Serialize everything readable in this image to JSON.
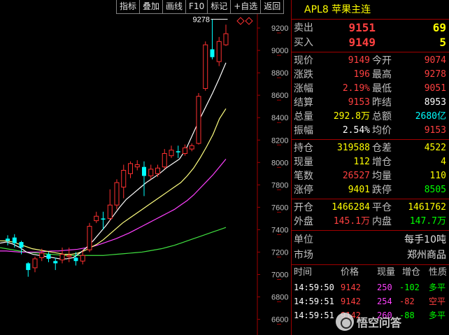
{
  "toolbar": [
    "指标",
    "叠加",
    "画线",
    "F10",
    "标记",
    "+自选",
    "返回"
  ],
  "symbol_title": "APL8 苹果主连",
  "chart_data": {
    "type": "candlestick",
    "y_ticks": [
      9200,
      9000,
      8800,
      8600,
      8400,
      8200,
      8000,
      7800,
      7600,
      7400,
      7200,
      7000,
      6800,
      6600
    ],
    "ylim": [
      6460,
      9450
    ],
    "annotation": "9278",
    "candles": [
      {
        "o": 7320,
        "c": 7300,
        "h": 7350,
        "l": 7260
      },
      {
        "o": 7330,
        "c": 7280,
        "h": 7360,
        "l": 7240
      },
      {
        "o": 7290,
        "c": 7240,
        "h": 7300,
        "l": 7180
      },
      {
        "o": 7100,
        "c": 7040,
        "h": 7110,
        "l": 6980
      },
      {
        "o": 7060,
        "c": 7140,
        "h": 7160,
        "l": 7020
      },
      {
        "o": 7150,
        "c": 7190,
        "h": 7230,
        "l": 7120
      },
      {
        "o": 7180,
        "c": 7140,
        "h": 7200,
        "l": 7110
      },
      {
        "o": 7120,
        "c": 7100,
        "h": 7150,
        "l": 7040
      },
      {
        "o": 7130,
        "c": 7180,
        "h": 7240,
        "l": 7100
      },
      {
        "o": 7160,
        "c": 7170,
        "h": 7240,
        "l": 7110
      },
      {
        "o": 7150,
        "c": 7120,
        "h": 7200,
        "l": 7080
      },
      {
        "o": 7120,
        "c": 7170,
        "h": 7220,
        "l": 7090
      },
      {
        "o": 7220,
        "c": 7430,
        "h": 7460,
        "l": 7200
      },
      {
        "o": 7480,
        "c": 7520,
        "h": 7560,
        "l": 7460
      },
      {
        "o": 7500,
        "c": 7490,
        "h": 7560,
        "l": 7400
      },
      {
        "o": 7500,
        "c": 7620,
        "h": 7760,
        "l": 7480
      },
      {
        "o": 7620,
        "c": 7820,
        "h": 7850,
        "l": 7580
      },
      {
        "o": 7780,
        "c": 7930,
        "h": 7980,
        "l": 7680
      },
      {
        "o": 7900,
        "c": 7990,
        "h": 8010,
        "l": 7860
      },
      {
        "o": 7960,
        "c": 7980,
        "h": 8020,
        "l": 7930
      },
      {
        "o": 7960,
        "c": 7880,
        "h": 8010,
        "l": 7700
      },
      {
        "o": 7880,
        "c": 7940,
        "h": 7980,
        "l": 7850
      },
      {
        "o": 7900,
        "c": 7950,
        "h": 7980,
        "l": 7870
      },
      {
        "o": 7960,
        "c": 8080,
        "h": 8120,
        "l": 7940
      },
      {
        "o": 8060,
        "c": 8110,
        "h": 8150,
        "l": 8040
      },
      {
        "o": 8100,
        "c": 8090,
        "h": 8150,
        "l": 8040
      },
      {
        "o": 8080,
        "c": 8130,
        "h": 8160,
        "l": 8060
      },
      {
        "o": 8120,
        "c": 8150,
        "h": 8170,
        "l": 8100
      },
      {
        "o": 8170,
        "c": 8590,
        "h": 8620,
        "l": 8160
      },
      {
        "o": 8660,
        "c": 9050,
        "h": 9080,
        "l": 8640
      },
      {
        "o": 9010,
        "c": 8940,
        "h": 9278,
        "l": 8920
      },
      {
        "o": 8900,
        "c": 9080,
        "h": 9120,
        "l": 8860
      },
      {
        "o": 9050,
        "c": 9149,
        "h": 9230,
        "l": 9040
      }
    ],
    "ma_white": [
      7280,
      7290,
      7270,
      7240,
      7200,
      7180,
      7170,
      7160,
      7150,
      7140,
      7140,
      7150,
      7190,
      7240,
      7300,
      7370,
      7440,
      7520,
      7600,
      7670,
      7720,
      7770,
      7820,
      7860,
      7900,
      7950,
      7990,
      8030,
      8120,
      8250,
      8380,
      8500,
      8620,
      8750,
      8890
    ],
    "ma_yellow": [
      7300,
      7300,
      7290,
      7270,
      7250,
      7230,
      7220,
      7210,
      7200,
      7190,
      7180,
      7180,
      7190,
      7210,
      7240,
      7270,
      7310,
      7360,
      7410,
      7460,
      7500,
      7540,
      7580,
      7620,
      7660,
      7700,
      7740,
      7780,
      7820,
      7880,
      7950,
      8040,
      8140,
      8250,
      8390,
      8480
    ],
    "ma_magenta": [
      7210,
      7210,
      7205,
      7200,
      7200,
      7200,
      7200,
      7205,
      7210,
      7210,
      7215,
      7220,
      7225,
      7235,
      7245,
      7260,
      7280,
      7300,
      7320,
      7345,
      7370,
      7400,
      7430,
      7460,
      7490,
      7520,
      7550,
      7580,
      7620,
      7660,
      7710,
      7770,
      7830,
      7890,
      7960,
      8030
    ],
    "ma_green": [
      7240,
      7230,
      7220,
      7210,
      7200,
      7195,
      7190,
      7185,
      7180,
      7175,
      7170,
      7170,
      7170,
      7170,
      7170,
      7170,
      7170,
      7175,
      7180,
      7185,
      7190,
      7195,
      7200,
      7210,
      7220,
      7230,
      7245,
      7260,
      7280,
      7300,
      7320,
      7340,
      7360,
      7380,
      7400,
      7420
    ]
  },
  "quote": {
    "sell": {
      "label": "卖出",
      "price": "9151",
      "vol": "69"
    },
    "buy": {
      "label": "买入",
      "price": "9149",
      "vol": "5"
    }
  },
  "stats1": [
    {
      "l1": "现价",
      "v1": "9149",
      "c1": "red",
      "l2": "今开",
      "v2": "9074",
      "c2": "red"
    },
    {
      "l1": "涨跌",
      "v1": "196",
      "c1": "red",
      "l2": "最高",
      "v2": "9278",
      "c2": "red"
    },
    {
      "l1": "涨幅",
      "v1": "2.19%",
      "c1": "red",
      "l2": "最低",
      "v2": "9051",
      "c2": "red"
    },
    {
      "l1": "结算",
      "v1": "9153",
      "c1": "red",
      "l2": "昨结",
      "v2": "8953",
      "c2": "white"
    },
    {
      "l1": "总量",
      "v1": "292.8万",
      "c1": "yellow",
      "l2": "总额",
      "v2": "2680亿",
      "c2": "cyan"
    },
    {
      "l1": "振幅",
      "v1": "2.54%",
      "c1": "white",
      "l2": "均价",
      "v2": "9153",
      "c2": "red"
    }
  ],
  "stats2": [
    {
      "l1": "持仓",
      "v1": "319588",
      "c1": "yellow",
      "l2": "仓差",
      "v2": "4522",
      "c2": "yellow"
    },
    {
      "l1": "现量",
      "v1": "112",
      "c1": "yellow",
      "l2": "增仓",
      "v2": "4",
      "c2": "yellow"
    },
    {
      "l1": "笔数",
      "v1": "26527",
      "c1": "red",
      "l2": "均量",
      "v2": "110",
      "c2": "yellow"
    },
    {
      "l1": "涨停",
      "v1": "9401",
      "c1": "yellow",
      "l2": "跌停",
      "v2": "8505",
      "c2": "green"
    }
  ],
  "stats3": [
    {
      "l1": "开仓",
      "v1": "1466284",
      "c1": "yellow",
      "l2": "平仓",
      "v2": "1461762",
      "c2": "yellow"
    },
    {
      "l1": "外盘",
      "v1": "145.1万",
      "c1": "red",
      "l2": "内盘",
      "v2": "147.7万",
      "c2": "green"
    }
  ],
  "info": [
    {
      "label": "单位",
      "value": "每手10吨"
    },
    {
      "label": "市场",
      "value": "郑州商品"
    }
  ],
  "ticks_header": [
    "时间",
    "价格",
    "现量",
    "增仓",
    "性质"
  ],
  "ticks": [
    {
      "time": "14:59:50",
      "price": "9142",
      "vol": "250",
      "oi": "-102",
      "kind": "多平",
      "kc": "green"
    },
    {
      "time": "14:59:51",
      "price": "9142",
      "vol": "254",
      "oi": "-82",
      "kind": "空平",
      "kc": "red"
    },
    {
      "time": "14:59:51",
      "price": "9142",
      "vol": "260",
      "oi": "-88",
      "kind": "多平",
      "kc": "green"
    }
  ],
  "watermark": "悟空问答",
  "colors": {
    "up": "#ff3030",
    "down": "#00ffff",
    "frame": "#a00000"
  }
}
